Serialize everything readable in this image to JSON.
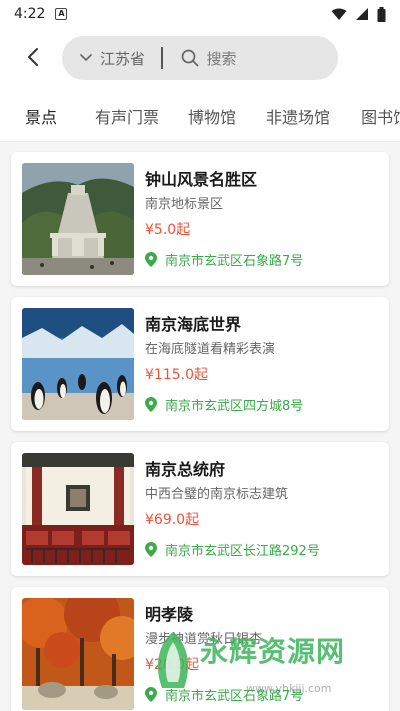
{
  "status_bar": {
    "time": "4:22",
    "notification_icon": "A"
  },
  "header": {
    "province": "江苏省",
    "search_placeholder": "搜索"
  },
  "tabs": [
    {
      "label": "景点",
      "active": true
    },
    {
      "label": "有声门票",
      "active": false
    },
    {
      "label": "博物馆",
      "active": false
    },
    {
      "label": "非遗场馆",
      "active": false
    },
    {
      "label": "图书馆",
      "active": false
    }
  ],
  "attractions": [
    {
      "title": "钟山风景名胜区",
      "subtitle": "南京地标景区",
      "price": "¥5.0起",
      "address": "南京市玄武区石象路7号",
      "image_icon": "mausoleum-image"
    },
    {
      "title": "南京海底世界",
      "subtitle": "在海底隧道看精彩表演",
      "price": "¥115.0起",
      "address": "南京市玄武区四方城8号",
      "image_icon": "penguin-image"
    },
    {
      "title": "南京总统府",
      "subtitle": "中西合璧的南京标志建筑",
      "price": "¥69.0起",
      "address": "南京市玄武区长江路292号",
      "image_icon": "hall-image"
    },
    {
      "title": "明孝陵",
      "subtitle": "漫步神道赏秋日银杏",
      "price": "¥20.0起",
      "address": "南京市玄武区石象路7号",
      "image_icon": "autumn-trees-image"
    }
  ],
  "watermark": {
    "text": "永辉资源网",
    "url": "www.yhkjjj.com"
  },
  "colors": {
    "price": "#e8553c",
    "address": "#3aaa4a"
  }
}
